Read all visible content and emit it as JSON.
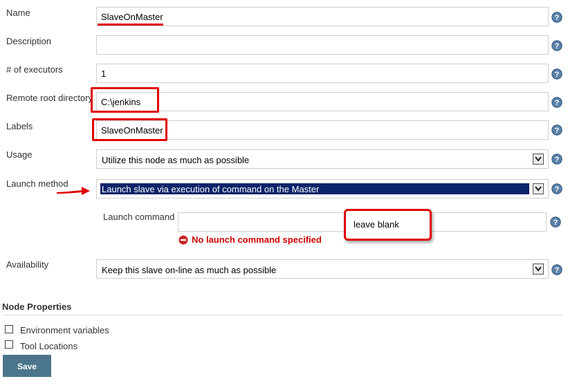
{
  "form": {
    "name": {
      "label": "Name",
      "value": "SlaveOnMaster"
    },
    "description": {
      "label": "Description",
      "value": ""
    },
    "executors": {
      "label": "# of executors",
      "value": "1"
    },
    "remote_root": {
      "label": "Remote root directory",
      "value": "C:\\jenkins"
    },
    "labels": {
      "label": "Labels",
      "value": "SlaveOnMaster"
    },
    "usage": {
      "label": "Usage",
      "selected": "Utilize this node as much as possible"
    },
    "launch_method": {
      "label": "Launch method",
      "selected": "Launch slave via execution of command on the Master"
    },
    "launch_command": {
      "label": "Launch command",
      "value": "",
      "error": "No launch command specified"
    },
    "availability": {
      "label": "Availability",
      "selected": "Keep this slave on-line as much as possible"
    }
  },
  "annotations": {
    "leave_blank": "leave blank"
  },
  "node_properties": {
    "heading": "Node Properties",
    "items": [
      {
        "label": "Environment variables",
        "checked": false
      },
      {
        "label": "Tool Locations",
        "checked": false
      }
    ]
  },
  "actions": {
    "save_label": "Save"
  },
  "colors": {
    "annotation_red": "#e00000",
    "selected_highlight": "#0a246a",
    "save_button": "#4b758b",
    "error_text": "#cc0000"
  }
}
